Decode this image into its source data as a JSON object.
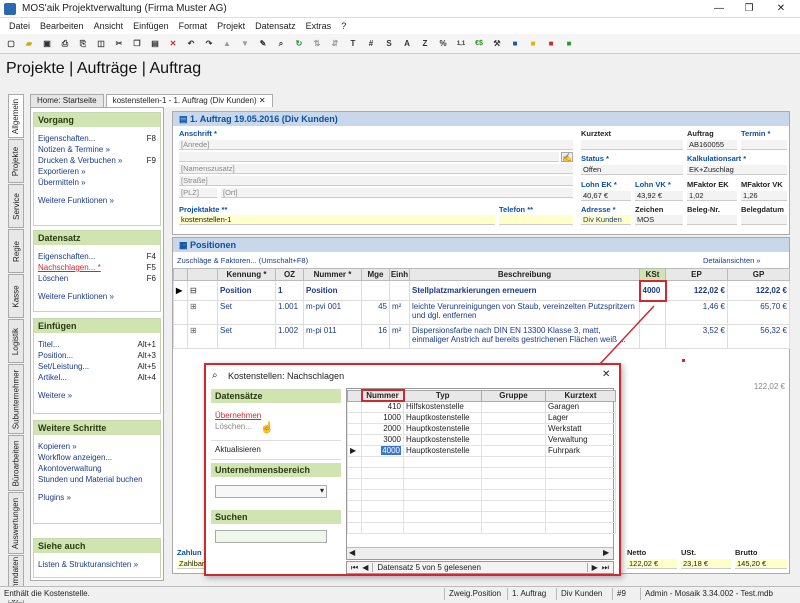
{
  "window": {
    "title": "MOS'aik Projektverwaltung (Firma Muster AG)"
  },
  "menu": [
    "Datei",
    "Bearbeiten",
    "Ansicht",
    "Einfügen",
    "Format",
    "Projekt",
    "Datensatz",
    "Extras",
    "?"
  ],
  "toolbar": {
    "text_buttons": [
      "T",
      "#",
      "S",
      "A",
      "Z",
      "%",
      "1,1",
      "€$"
    ]
  },
  "page_title": "Projekte | Aufträge | Auftrag",
  "side_tabs": [
    "Allgemein",
    "Projekte",
    "Service",
    "Regie",
    "Kasse",
    "Logistik",
    "Subunternehmer",
    "Büroarbeiten",
    "Auswertungen",
    "Stammdaten"
  ],
  "doc_tabs": [
    {
      "label": "Home: Startseite"
    },
    {
      "label": "kostenstellen-1 - 1. Auftrag (Div Kunden)"
    }
  ],
  "left_panel": {
    "vorgang": {
      "title": "Vorgang",
      "items": [
        {
          "label": "Eigenschaften...",
          "key": "F8"
        },
        {
          "label": "Notizen & Termine »",
          "key": ""
        },
        {
          "label": "Drucken & Verbuchen »",
          "key": "F9"
        },
        {
          "label": "Exportieren »",
          "key": ""
        },
        {
          "label": "Übermitteln »",
          "key": ""
        }
      ],
      "more": "Weitere Funktionen »"
    },
    "datensatz": {
      "title": "Datensatz",
      "items": [
        {
          "label": "Eigenschaften...",
          "key": "F4"
        },
        {
          "label": "Nachschlagen... *",
          "key": "F5"
        },
        {
          "label": "Löschen",
          "key": "F6"
        }
      ],
      "more": "Weitere Funktionen »"
    },
    "einfuegen": {
      "title": "Einfügen",
      "items": [
        {
          "label": "Titel...",
          "key": "Alt+1"
        },
        {
          "label": "Position...",
          "key": "Alt+3"
        },
        {
          "label": "Set/Leistung...",
          "key": "Alt+5"
        },
        {
          "label": "Artikel...",
          "key": "Alt+4"
        }
      ],
      "more": "Weitere »"
    },
    "schritte": {
      "title": "Weitere Schritte",
      "items": [
        {
          "label": "Kopieren »"
        },
        {
          "label": "Workflow anzeigen..."
        },
        {
          "label": "Akontoverwaltung"
        },
        {
          "label": "Stunden und Material buchen"
        }
      ],
      "more": "Plugins »"
    },
    "siehe": {
      "title": "Siehe auch",
      "items": [
        {
          "label": "Listen & Strukturansichten »"
        }
      ]
    }
  },
  "order": {
    "header": "1. Auftrag 19.05.2016 (Div Kunden)",
    "anschrift_label": "Anschrift *",
    "anrede": "[Anrede]",
    "namenszusatz": "[Namenszusatz]",
    "strasse": "[Straße]",
    "plz": "[PLZ]",
    "ort": "[Ort]",
    "projektakte_label": "Projektakte **",
    "projektakte": "kostenstellen-1",
    "telefon_label": "Telefon **",
    "kurztext_label": "Kurztext",
    "auftrag_label": "Auftrag",
    "auftrag": "AB160055",
    "termin_label": "Termin *",
    "status_label": "Status *",
    "status": "Offen",
    "kalk_label": "Kalkulationsart *",
    "kalk": "EK+Zuschlag",
    "lohn_ek_label": "Lohn EK *",
    "lohn_ek": "40,67 €",
    "lohn_vk_label": "Lohn VK *",
    "lohn_vk": "43,92 €",
    "mf_ek_label": "MFaktor EK",
    "mf_ek": "1,02",
    "mf_vk_label": "MFaktor VK",
    "mf_vk": "1,26",
    "adresse_label": "Adresse *",
    "adresse": "Div Kunden",
    "zeichen_label": "Zeichen",
    "zeichen": "MOS",
    "beleg_nr_label": "Beleg-Nr.",
    "belegdatum_label": "Belegdatum"
  },
  "positions": {
    "title": "Positionen",
    "sub_link": "Zuschläge & Faktoren... (Umschalt+F8)",
    "detail_link": "Detailansichten »",
    "columns": [
      "Kennung *",
      "OZ",
      "Nummer *",
      "Mge",
      "Einh",
      "Beschreibung",
      "KSt",
      "EP",
      "GP"
    ],
    "rows": [
      {
        "kennung": "Position",
        "oz": "1",
        "nummer": "Position",
        "mge": "",
        "einh": "",
        "beschreibung": "Stellplatzmarkierungen erneuern",
        "kst": "4000",
        "ep": "122,02 €",
        "gp": "122,02 €"
      },
      {
        "kennung": "Set",
        "oz": "1.001",
        "nummer": "m-pvi 001",
        "mge": "45",
        "einh": "m²",
        "beschreibung": "leichte Verunreinigungen von Staub, vereinzelten Putzspritzern und dgl. entfernen",
        "kst": "",
        "ep": "1,46 €",
        "gp": "65,70 €"
      },
      {
        "kennung": "Set",
        "oz": "1.002",
        "nummer": "m-pi 011",
        "mge": "16",
        "einh": "m²",
        "beschreibung": "Dispersionsfarbe nach DIN EN 13300 Klasse 3, matt, einmaliger Anstrich auf bereits gestrichenen Flächen weiß ...",
        "kst": "",
        "ep": "3,52 €",
        "gp": "56,32 €"
      }
    ],
    "total_gp": "122,02 €",
    "sum_label": "Zahlun",
    "sum_value": "Zahlbar",
    "netto_label": "Netto",
    "netto": "122,02 €",
    "ust_label": "USt.",
    "ust": "23,18 €",
    "brutto_label": "Brutto",
    "brutto": "145,20 €"
  },
  "popup": {
    "title": "Kostenstellen: Nachschlagen",
    "grp1": "Datensätze",
    "uebernehmen": "Übernehmen",
    "loeschen": "Löschen...",
    "aktualisieren": "Aktualisieren",
    "grp2": "Unternehmensbereich",
    "grp3": "Suchen",
    "columns": [
      "Nummer",
      "Typ",
      "Gruppe",
      "Kurztext"
    ],
    "rows": [
      {
        "nummer": "410",
        "typ": "Hilfskostenstelle",
        "gruppe": "",
        "kurztext": "Garagen"
      },
      {
        "nummer": "1000",
        "typ": "Hauptkostenstelle",
        "gruppe": "",
        "kurztext": "Lager"
      },
      {
        "nummer": "2000",
        "typ": "Hauptkostenstelle",
        "gruppe": "",
        "kurztext": "Werkstatt"
      },
      {
        "nummer": "3000",
        "typ": "Hauptkostenstelle",
        "gruppe": "",
        "kurztext": "Verwaltung"
      },
      {
        "nummer": "4000",
        "typ": "Hauptkostenstelle",
        "gruppe": "",
        "kurztext": "Fuhrpark"
      }
    ],
    "nav": "Datensatz 5 von 5 gelesenen"
  },
  "statusbar": {
    "left": "Enthält die Kostenstelle.",
    "zweig": "Zweig.Position",
    "auftrag": "1. Auftrag",
    "kunde": "Div Kunden",
    "nr": "#9",
    "admin": "Admin - Mosaik 3.34.002 - Test.mdb"
  },
  "colors": {
    "accent": "#0b4fa8",
    "green_header": "#cfe4b0",
    "highlight": "#d0282e"
  }
}
